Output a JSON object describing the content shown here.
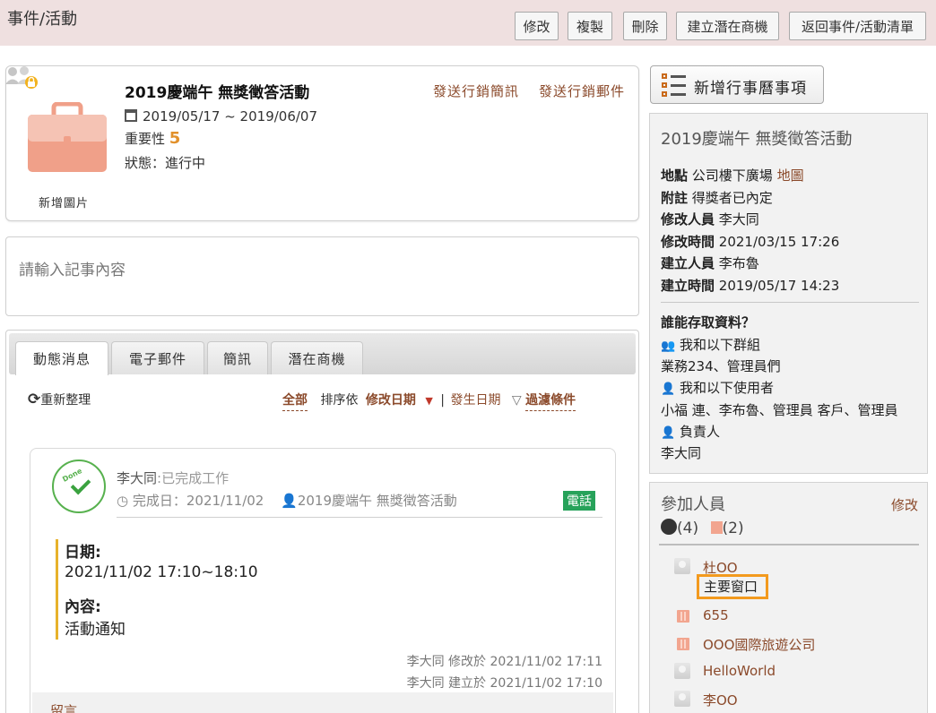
{
  "header": {
    "title": "事件/活動",
    "buttons": {
      "edit": "修改",
      "copy": "複製",
      "delete": "刪除",
      "create_opportunity": "建立潛在商機",
      "back": "返回事件/活動清單"
    }
  },
  "event": {
    "title": "2019慶端午 無獎徵答活動",
    "send_sms": "發送行銷簡訊",
    "send_email": "發送行銷郵件",
    "date_range": "2019/05/17 ~ 2019/06/07",
    "importance_label": "重要性",
    "importance_value": "5",
    "status": "狀態：進行中",
    "add_image": "新增圖片"
  },
  "note": {
    "placeholder": "請輸入記事內容"
  },
  "tabs": [
    "動態消息",
    "電子郵件",
    "簡訊",
    "潛在商機"
  ],
  "toolbar": {
    "refresh": "重新整理",
    "all": "全部",
    "sort_by": "排序依",
    "sort_field": "修改日期",
    "separator": "|",
    "occur_date": "發生日期",
    "filter": "過濾條件"
  },
  "feed_item": {
    "done_text": "Done",
    "user": "李大同",
    "action": ":已完成工作",
    "completed": "完成日：2021/11/02",
    "event_ref": "2019慶端午 無獎徵答活動",
    "tag": "電話",
    "date_label": "日期:",
    "date_value": "2021/11/02 17:10~18:10",
    "content_label": "內容:",
    "content_value": "活動通知",
    "modified": "李大同 修改於 2021/11/02 17:11",
    "created": "李大同 建立於 2021/11/02 17:10",
    "comment": "留言"
  },
  "sidebar": {
    "add_calendar": "新增行事曆事項",
    "info": {
      "title": "2019慶端午 無獎徵答活動",
      "location_label": "地點",
      "location_value": "公司樓下廣場",
      "map_link": "地圖",
      "remark_label": "附註",
      "remark_value": "得獎者已內定",
      "modifier_label": "修改人員",
      "modifier_value": "李大同",
      "modified_label": "修改時間",
      "modified_value": "2021/03/15 17:26",
      "creator_label": "建立人員",
      "creator_value": "李布魯",
      "created_label": "建立時間",
      "created_value": "2019/05/17 14:23",
      "access_title": "誰能存取資料？",
      "groups_label": "我和以下群組",
      "groups_value": "業務234、管理員們",
      "users_label": "我和以下使用者",
      "users_value": "小福 連、李布魯、管理員 客戶、管理員",
      "owner_label": "負責人",
      "owner_value": "李大同"
    },
    "participants": {
      "title": "參加人員",
      "edit": "修改",
      "people_count": "(4)",
      "company_count": "(2)",
      "items": [
        {
          "name": "杜OO",
          "role": "主要窗口"
        },
        {
          "name": "655"
        },
        {
          "name": "OOO國際旅遊公司"
        },
        {
          "name": "HelloWorld"
        },
        {
          "name": "李OO"
        }
      ]
    }
  }
}
